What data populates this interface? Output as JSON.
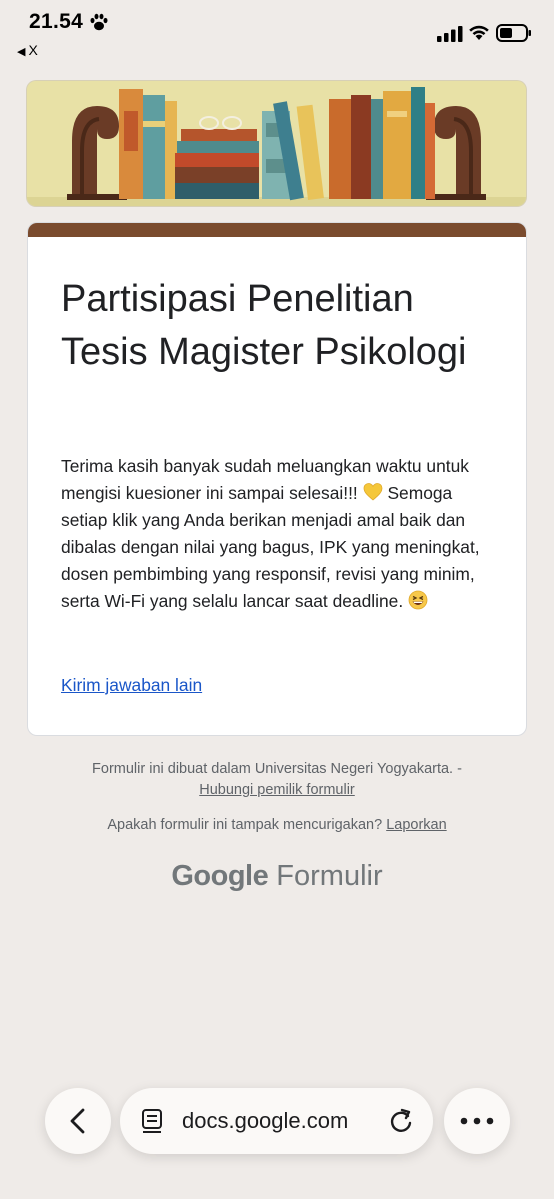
{
  "status_bar": {
    "time": "21.54",
    "back_app": "X"
  },
  "form": {
    "title": "Partisipasi Penelitian Tesis Magister Psikologi",
    "description_part1": "Terima kasih banyak sudah meluangkan waktu untuk mengisi kuesioner ini sampai selesai!!!",
    "description_part2": "Semoga setiap klik yang Anda berikan menjadi amal baik dan dibalas dengan nilai yang bagus, IPK yang meningkat, dosen pembimbing yang responsif, revisi yang minim, serta Wi-Fi yang selalu lancar saat deadline.",
    "another_response_link": "Kirim jawaban lain"
  },
  "footer": {
    "created_in": "Formulir ini dibuat dalam Universitas Negeri Yogyakarta. -",
    "contact_owner": "Hubungi pemilik formulir",
    "suspicious_question": "Apakah formulir ini tampak mencurigakan?",
    "report_link": "Laporkan",
    "brand_google": "Google",
    "brand_forms": "Formulir"
  },
  "browser": {
    "url": "docs.google.com"
  },
  "colors": {
    "theme_header": "#7a4b2e",
    "link": "#1a56c8",
    "background": "#efebe8"
  }
}
